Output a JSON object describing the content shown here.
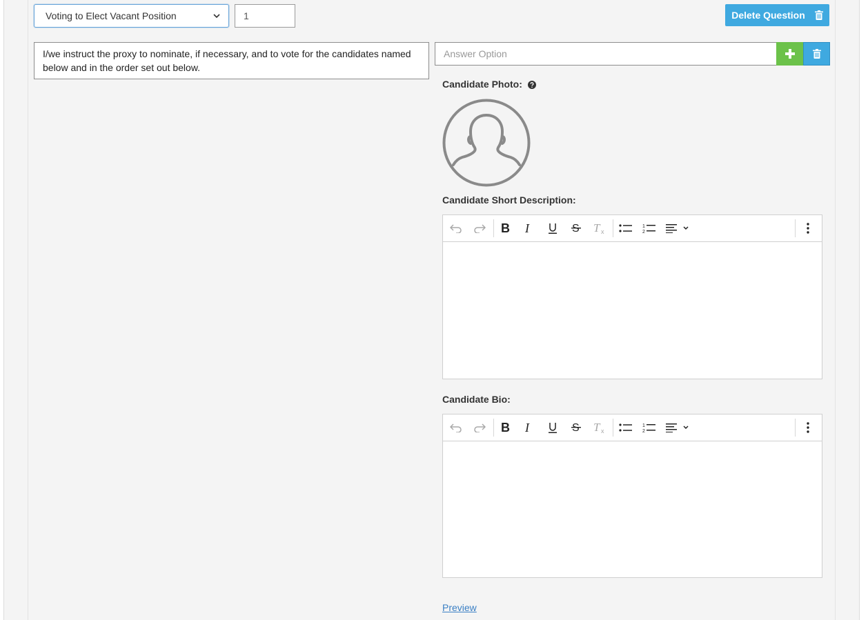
{
  "question": {
    "type_select": {
      "value": "Voting to Elect Vacant Position",
      "icon": "chevron-down-icon"
    },
    "order_value": "1",
    "delete_button": {
      "label": "Delete Question",
      "icon": "trash-icon"
    },
    "text": "I/we instruct the proxy to nominate, if necessary, and to vote for the candidates named below and in the order set out below."
  },
  "answer": {
    "placeholder": "Answer Option",
    "add_icon": "plus-icon",
    "delete_icon": "trash-icon"
  },
  "candidate": {
    "photo_label": "Candidate Photo:",
    "photo_help_icon": "question-circle-icon",
    "avatar_icon": "user-silhouette-icon",
    "short_description_label": "Candidate Short Description:",
    "bio_label": "Candidate Bio:"
  },
  "editor_toolbar": {
    "buttons": [
      "undo-icon",
      "redo-icon",
      "bold-icon",
      "italic-icon",
      "underline-icon",
      "strikethrough-icon",
      "clear-formatting-icon",
      "bullet-list-icon",
      "numbered-list-icon",
      "align-icon",
      "more-icon"
    ]
  },
  "preview_label": "Preview",
  "colors": {
    "primary": "#3fa9e0",
    "success": "#6cc24a",
    "panel_bg": "#f4f4f4",
    "link": "#3a7fc4"
  }
}
